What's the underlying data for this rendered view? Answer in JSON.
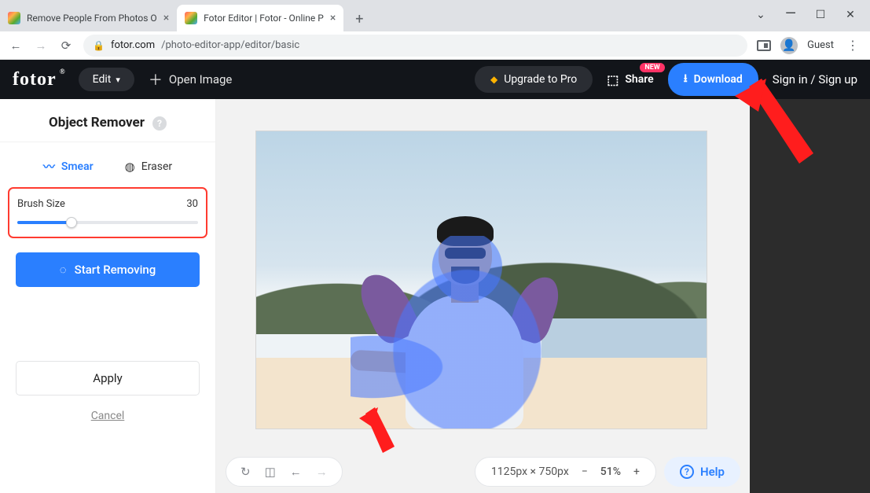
{
  "browser": {
    "tabs": [
      {
        "title": "Remove People From Photos O",
        "active": false
      },
      {
        "title": "Fotor Editor | Fotor - Online P",
        "active": true
      }
    ],
    "guest_label": "Guest",
    "url_domain": "fotor.com",
    "url_path": "/photo-editor-app/editor/basic"
  },
  "header": {
    "logo": "fotor",
    "edit_label": "Edit",
    "open_image_label": "Open Image",
    "upgrade_label": "Upgrade to Pro",
    "share_label": "Share",
    "share_badge": "NEW",
    "download_label": "Download",
    "signin_label": "Sign in / Sign up"
  },
  "panel": {
    "title": "Object Remover",
    "tool_tabs": {
      "smear": "Smear",
      "eraser": "Eraser"
    },
    "brush_label": "Brush Size",
    "brush_value": "30",
    "start_label": "Start Removing",
    "apply_label": "Apply",
    "cancel_label": "Cancel"
  },
  "bottombar": {
    "dimensions": "1125px × 750px",
    "zoom_pct": "51%",
    "help_label": "Help"
  }
}
